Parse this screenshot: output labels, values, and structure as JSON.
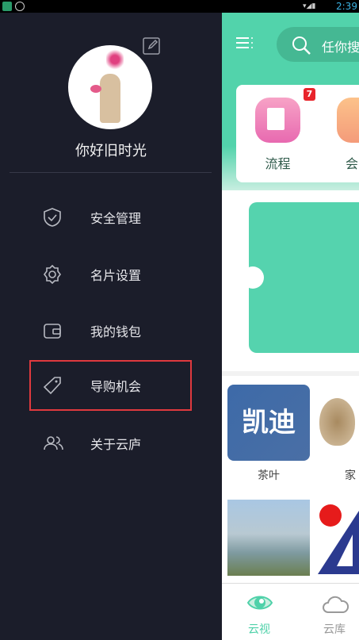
{
  "status_bar": {
    "time": "2:39"
  },
  "drawer": {
    "user_name": "你好旧时光",
    "menu": [
      {
        "label": "安全管理",
        "icon": "shield-check-icon"
      },
      {
        "label": "名片设置",
        "icon": "gear-icon"
      },
      {
        "label": "我的钱包",
        "icon": "wallet-icon"
      },
      {
        "label": "导购机会",
        "icon": "tag-icon",
        "highlighted": true
      },
      {
        "label": "关于云庐",
        "icon": "users-icon"
      }
    ],
    "highlight_color": "#e0393e"
  },
  "main": {
    "search_placeholder": "任你搜",
    "quick_apps": [
      {
        "label": "流程",
        "badge": "7"
      },
      {
        "label": "会"
      }
    ],
    "grid": [
      {
        "label": "茶叶",
        "logo_text": "凯迪"
      },
      {
        "label": "家"
      },
      {
        "label": ""
      },
      {
        "label": ""
      }
    ],
    "accent": "#4fd1a9"
  },
  "bottom_nav": [
    {
      "label": "云视",
      "active": true
    },
    {
      "label": "云库"
    }
  ]
}
